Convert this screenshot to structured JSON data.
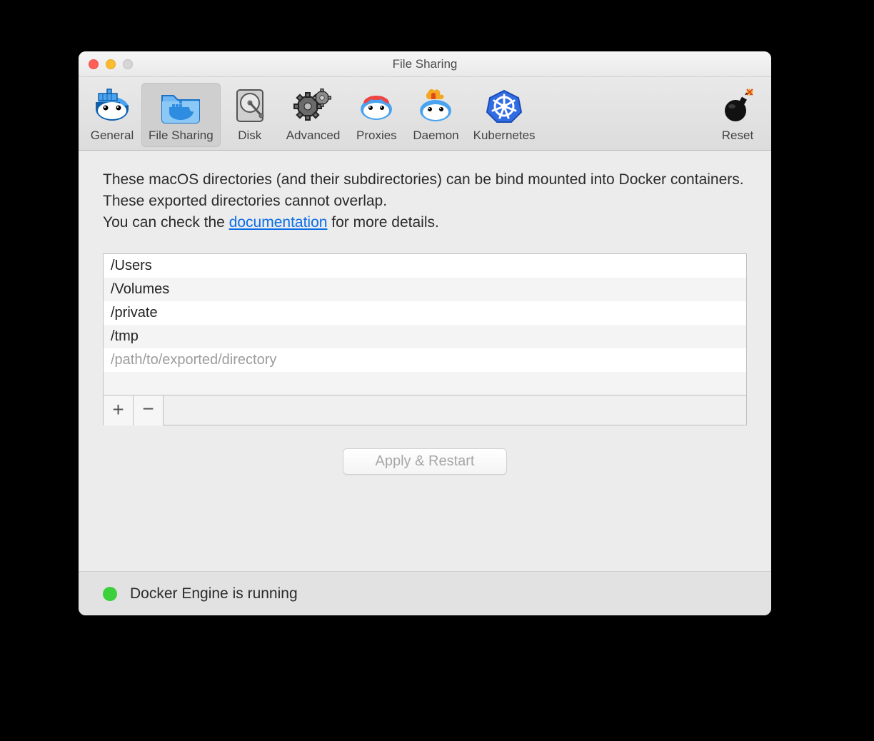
{
  "window": {
    "title": "File Sharing"
  },
  "toolbar": {
    "tabs": [
      {
        "id": "general",
        "label": "General"
      },
      {
        "id": "filesharing",
        "label": "File Sharing"
      },
      {
        "id": "disk",
        "label": "Disk"
      },
      {
        "id": "advanced",
        "label": "Advanced"
      },
      {
        "id": "proxies",
        "label": "Proxies"
      },
      {
        "id": "daemon",
        "label": "Daemon"
      },
      {
        "id": "kubernetes",
        "label": "Kubernetes"
      }
    ],
    "reset": {
      "label": "Reset"
    },
    "selected_tab_index": 1
  },
  "description": {
    "line1": "These macOS directories (and their subdirectories) can be bind mounted into Docker containers. These exported directories cannot overlap.",
    "line2_prefix": "You can check the ",
    "line2_link": "documentation",
    "line2_suffix": " for more details."
  },
  "paths": {
    "items": [
      "/Users",
      "/Volumes",
      "/private",
      "/tmp"
    ],
    "placeholder": "/path/to/exported/directory"
  },
  "buttons": {
    "apply": "Apply & Restart"
  },
  "status": {
    "text": "Docker Engine is running",
    "color": "#3cd03c"
  }
}
